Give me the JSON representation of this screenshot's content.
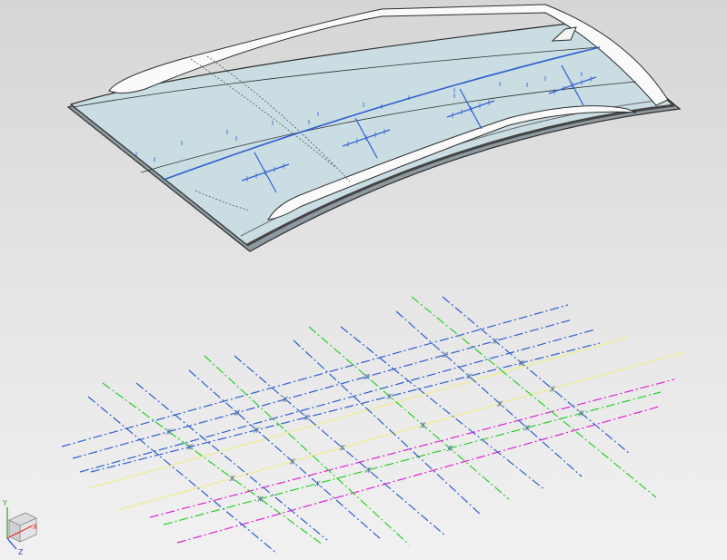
{
  "viewport": {
    "background_top": "#d6d6d6",
    "background_bottom": "#f1f1f1"
  },
  "model": {
    "panel_color": "#c9dde3",
    "rail_color": "#fafafa",
    "edge_color": "#2e2e2e",
    "curve_color": "#2f5fd0"
  },
  "grid": {
    "colors": {
      "blue": "#2f5fcf",
      "green": "#2ad02a",
      "yellow": "#f0ec8a",
      "magenta": "#e020d8"
    }
  },
  "triad": {
    "x_label": "X",
    "y_label": "Y",
    "z_label": "Z",
    "x_color": "#e03030",
    "y_color": "#2a9a2a",
    "z_color": "#2a40e0"
  }
}
